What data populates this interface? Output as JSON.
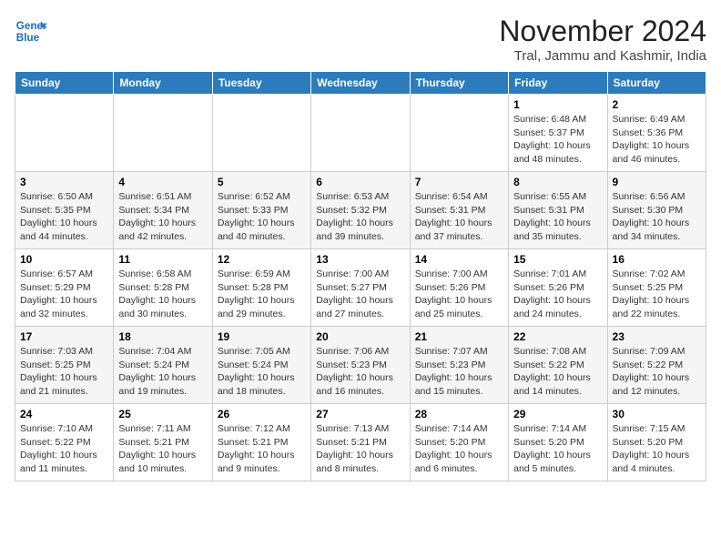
{
  "header": {
    "logo_line1": "General",
    "logo_line2": "Blue",
    "month": "November 2024",
    "location": "Tral, Jammu and Kashmir, India"
  },
  "weekdays": [
    "Sunday",
    "Monday",
    "Tuesday",
    "Wednesday",
    "Thursday",
    "Friday",
    "Saturday"
  ],
  "weeks": [
    [
      {
        "day": "",
        "info": ""
      },
      {
        "day": "",
        "info": ""
      },
      {
        "day": "",
        "info": ""
      },
      {
        "day": "",
        "info": ""
      },
      {
        "day": "",
        "info": ""
      },
      {
        "day": "1",
        "info": "Sunrise: 6:48 AM\nSunset: 5:37 PM\nDaylight: 10 hours and 48 minutes."
      },
      {
        "day": "2",
        "info": "Sunrise: 6:49 AM\nSunset: 5:36 PM\nDaylight: 10 hours and 46 minutes."
      }
    ],
    [
      {
        "day": "3",
        "info": "Sunrise: 6:50 AM\nSunset: 5:35 PM\nDaylight: 10 hours and 44 minutes."
      },
      {
        "day": "4",
        "info": "Sunrise: 6:51 AM\nSunset: 5:34 PM\nDaylight: 10 hours and 42 minutes."
      },
      {
        "day": "5",
        "info": "Sunrise: 6:52 AM\nSunset: 5:33 PM\nDaylight: 10 hours and 40 minutes."
      },
      {
        "day": "6",
        "info": "Sunrise: 6:53 AM\nSunset: 5:32 PM\nDaylight: 10 hours and 39 minutes."
      },
      {
        "day": "7",
        "info": "Sunrise: 6:54 AM\nSunset: 5:31 PM\nDaylight: 10 hours and 37 minutes."
      },
      {
        "day": "8",
        "info": "Sunrise: 6:55 AM\nSunset: 5:31 PM\nDaylight: 10 hours and 35 minutes."
      },
      {
        "day": "9",
        "info": "Sunrise: 6:56 AM\nSunset: 5:30 PM\nDaylight: 10 hours and 34 minutes."
      }
    ],
    [
      {
        "day": "10",
        "info": "Sunrise: 6:57 AM\nSunset: 5:29 PM\nDaylight: 10 hours and 32 minutes."
      },
      {
        "day": "11",
        "info": "Sunrise: 6:58 AM\nSunset: 5:28 PM\nDaylight: 10 hours and 30 minutes."
      },
      {
        "day": "12",
        "info": "Sunrise: 6:59 AM\nSunset: 5:28 PM\nDaylight: 10 hours and 29 minutes."
      },
      {
        "day": "13",
        "info": "Sunrise: 7:00 AM\nSunset: 5:27 PM\nDaylight: 10 hours and 27 minutes."
      },
      {
        "day": "14",
        "info": "Sunrise: 7:00 AM\nSunset: 5:26 PM\nDaylight: 10 hours and 25 minutes."
      },
      {
        "day": "15",
        "info": "Sunrise: 7:01 AM\nSunset: 5:26 PM\nDaylight: 10 hours and 24 minutes."
      },
      {
        "day": "16",
        "info": "Sunrise: 7:02 AM\nSunset: 5:25 PM\nDaylight: 10 hours and 22 minutes."
      }
    ],
    [
      {
        "day": "17",
        "info": "Sunrise: 7:03 AM\nSunset: 5:25 PM\nDaylight: 10 hours and 21 minutes."
      },
      {
        "day": "18",
        "info": "Sunrise: 7:04 AM\nSunset: 5:24 PM\nDaylight: 10 hours and 19 minutes."
      },
      {
        "day": "19",
        "info": "Sunrise: 7:05 AM\nSunset: 5:24 PM\nDaylight: 10 hours and 18 minutes."
      },
      {
        "day": "20",
        "info": "Sunrise: 7:06 AM\nSunset: 5:23 PM\nDaylight: 10 hours and 16 minutes."
      },
      {
        "day": "21",
        "info": "Sunrise: 7:07 AM\nSunset: 5:23 PM\nDaylight: 10 hours and 15 minutes."
      },
      {
        "day": "22",
        "info": "Sunrise: 7:08 AM\nSunset: 5:22 PM\nDaylight: 10 hours and 14 minutes."
      },
      {
        "day": "23",
        "info": "Sunrise: 7:09 AM\nSunset: 5:22 PM\nDaylight: 10 hours and 12 minutes."
      }
    ],
    [
      {
        "day": "24",
        "info": "Sunrise: 7:10 AM\nSunset: 5:22 PM\nDaylight: 10 hours and 11 minutes."
      },
      {
        "day": "25",
        "info": "Sunrise: 7:11 AM\nSunset: 5:21 PM\nDaylight: 10 hours and 10 minutes."
      },
      {
        "day": "26",
        "info": "Sunrise: 7:12 AM\nSunset: 5:21 PM\nDaylight: 10 hours and 9 minutes."
      },
      {
        "day": "27",
        "info": "Sunrise: 7:13 AM\nSunset: 5:21 PM\nDaylight: 10 hours and 8 minutes."
      },
      {
        "day": "28",
        "info": "Sunrise: 7:14 AM\nSunset: 5:20 PM\nDaylight: 10 hours and 6 minutes."
      },
      {
        "day": "29",
        "info": "Sunrise: 7:14 AM\nSunset: 5:20 PM\nDaylight: 10 hours and 5 minutes."
      },
      {
        "day": "30",
        "info": "Sunrise: 7:15 AM\nSunset: 5:20 PM\nDaylight: 10 hours and 4 minutes."
      }
    ]
  ]
}
